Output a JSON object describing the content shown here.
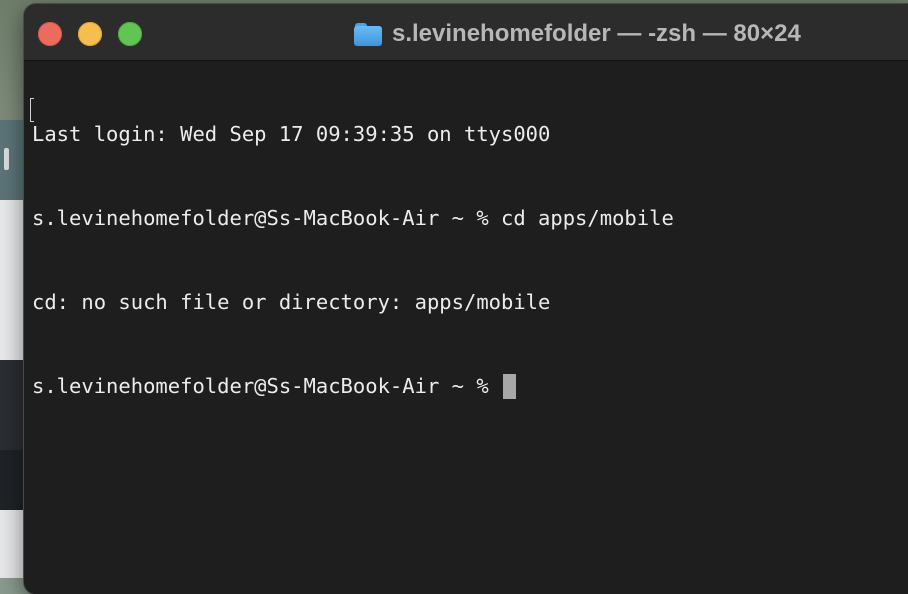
{
  "window": {
    "title": "s.levinehomefolder — -zsh — 80×24",
    "folder_icon": "folder-icon",
    "controls": {
      "close": "close-icon",
      "minimize": "minimize-icon",
      "maximize": "maximize-icon"
    }
  },
  "terminal": {
    "lines": [
      "Last login: Wed Sep 17 09:39:35 on ttys000",
      "s.levinehomefolder@Ss-MacBook-Air ~ % cd apps/mobile",
      "cd: no such file or directory: apps/mobile",
      "s.levinehomefolder@Ss-MacBook-Air ~ % "
    ],
    "background": "#1e1e1e",
    "text_color": "#ececec",
    "cursor_color": "#a7a7a7"
  }
}
